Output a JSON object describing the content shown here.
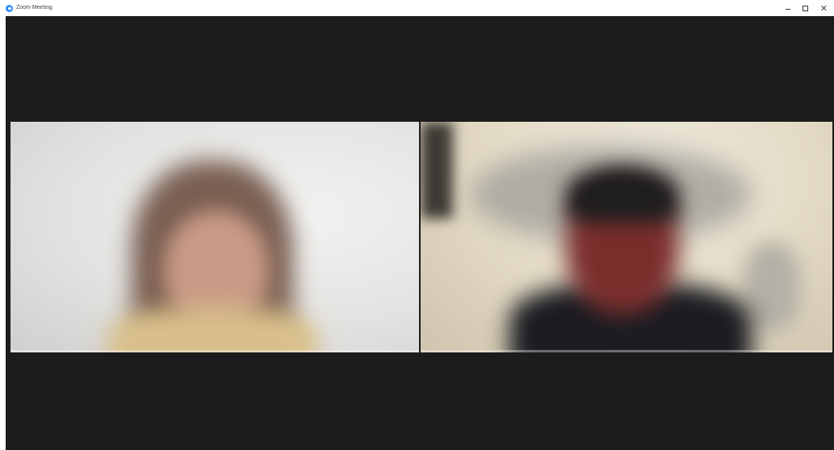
{
  "window": {
    "title": "Zoom Meeting"
  },
  "titlebar": {
    "minimize": "–",
    "maximize": "□",
    "close": "✕"
  },
  "icons": {
    "app": "zoom-camera-icon",
    "minimize": "minimize-icon",
    "maximize": "maximize-icon",
    "close": "close-icon"
  },
  "colors": {
    "zoom_blue": "#2d8cff",
    "meeting_background": "#1c1c1c"
  },
  "participants": [
    {
      "position": "left"
    },
    {
      "position": "right"
    }
  ]
}
